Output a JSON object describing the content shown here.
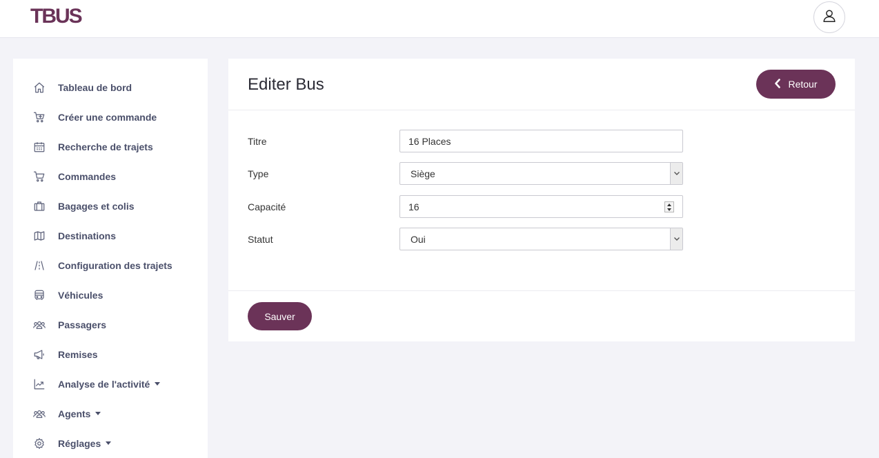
{
  "brand": {
    "logo": "TBUS",
    "accent": "#6b3358"
  },
  "header": {
    "user_icon": "user-icon"
  },
  "sidebar": {
    "items": [
      {
        "label": "Tableau de bord",
        "icon": "home-icon"
      },
      {
        "label": "Créer une commande",
        "icon": "cart-add-icon"
      },
      {
        "label": "Recherche de trajets",
        "icon": "calendar-icon"
      },
      {
        "label": "Commandes",
        "icon": "cart-icon"
      },
      {
        "label": "Bagages et colis",
        "icon": "briefcase-icon"
      },
      {
        "label": "Destinations",
        "icon": "map-icon"
      },
      {
        "label": "Configuration des trajets",
        "icon": "road-icon"
      },
      {
        "label": "Véhicules",
        "icon": "bus-icon"
      },
      {
        "label": "Passagers",
        "icon": "users-icon"
      },
      {
        "label": "Remises",
        "icon": "megaphone-icon"
      },
      {
        "label": "Analyse de l'activité",
        "icon": "chart-icon"
      },
      {
        "label": "Agents",
        "icon": "users-icon"
      },
      {
        "label": "Réglages",
        "icon": "gear-icon"
      }
    ]
  },
  "page": {
    "title": "Editer Bus",
    "back_label": "Retour",
    "save_label": "Sauver"
  },
  "form": {
    "titre_label": "Titre",
    "titre_value": "16 Places",
    "type_label": "Type",
    "type_value": "Siège",
    "capacite_label": "Capacité",
    "capacite_value": "16",
    "statut_label": "Statut",
    "statut_value": "Oui"
  }
}
